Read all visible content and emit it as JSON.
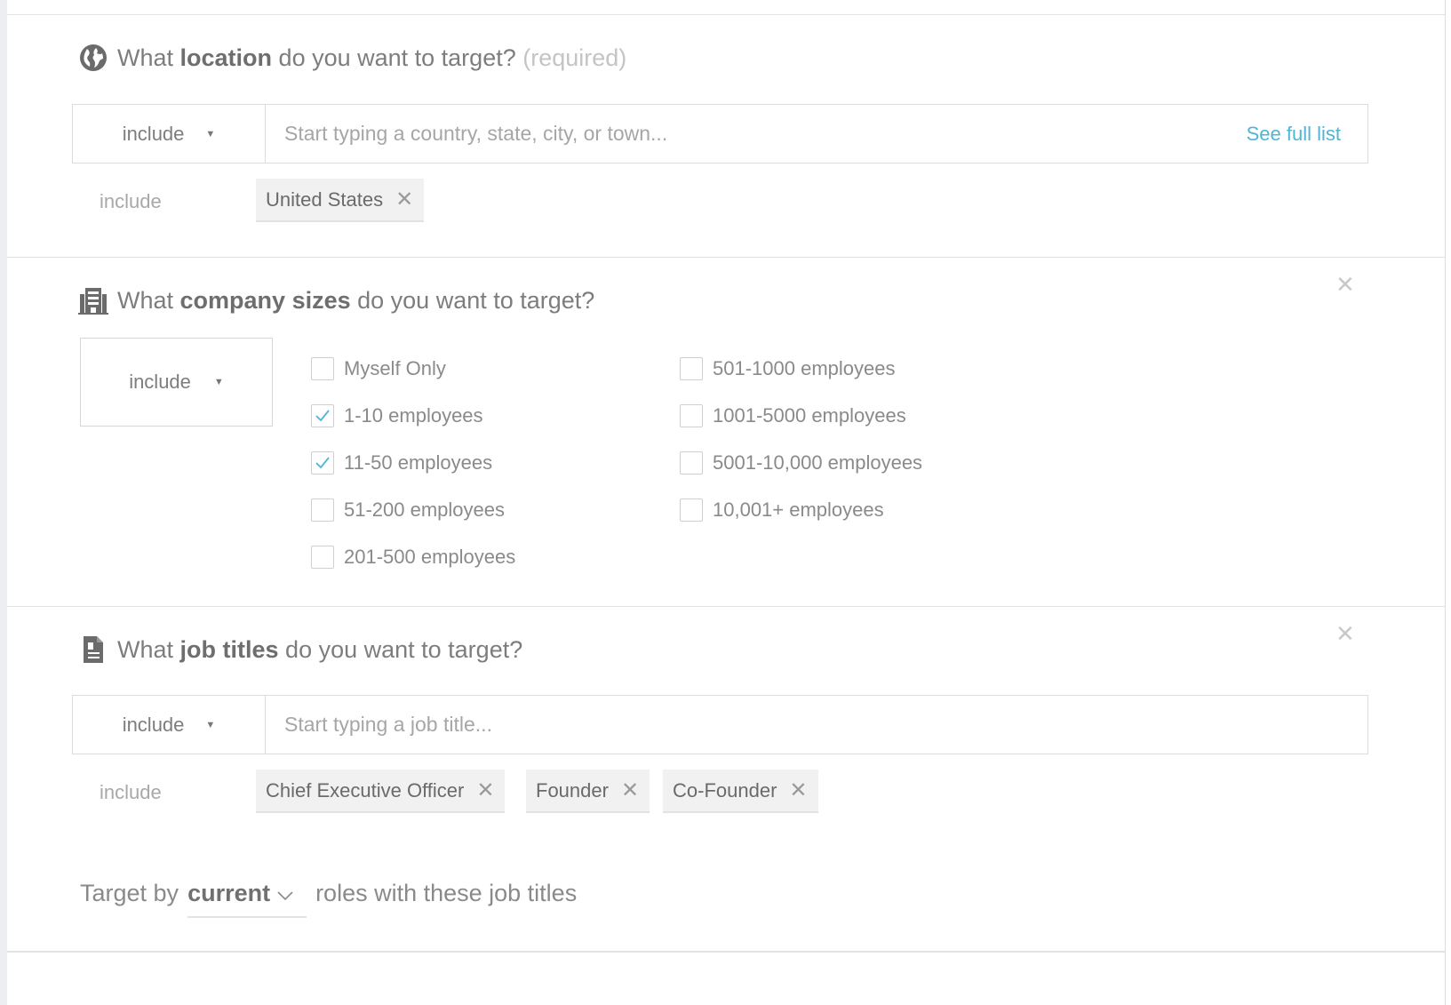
{
  "location": {
    "heading_pre": "What ",
    "heading_bold": "location",
    "heading_post": " do you want to target?",
    "heading_req": " (required)",
    "mode": "include",
    "placeholder": "Start typing a country, state, city, or town...",
    "see_full_list": "See full list",
    "include_label": "include",
    "tags": [
      "United States"
    ]
  },
  "company": {
    "heading_pre": "What ",
    "heading_bold": "company sizes",
    "heading_post": " do you want to target?",
    "mode": "include",
    "options": [
      {
        "label": "Myself Only",
        "checked": false
      },
      {
        "label": "1-10 employees",
        "checked": true
      },
      {
        "label": "11-50 employees",
        "checked": true
      },
      {
        "label": "51-200 employees",
        "checked": false
      },
      {
        "label": "201-500 employees",
        "checked": false
      },
      {
        "label": "501-1000 employees",
        "checked": false
      },
      {
        "label": "1001-5000 employees",
        "checked": false
      },
      {
        "label": "5001-10,000 employees",
        "checked": false
      },
      {
        "label": "10,001+ employees",
        "checked": false
      }
    ]
  },
  "jobs": {
    "heading_pre": "What ",
    "heading_bold": "job titles",
    "heading_post": " do you want to target?",
    "mode": "include",
    "placeholder": "Start typing a job title...",
    "include_label": "include",
    "tags": [
      "Chief Executive Officer",
      "Founder",
      "Co-Founder"
    ],
    "target_prefix": "Target by",
    "target_value": "current",
    "target_suffix": "roles with these job titles"
  },
  "icons": {
    "location": "globe-icon",
    "company": "building-icon",
    "jobs": "document-icon",
    "close": "close-icon",
    "remove": "remove-tag-icon",
    "caret": "caret-down-icon",
    "check": "checkmark-icon"
  },
  "colors": {
    "link": "#4fb5d6",
    "check": "#4fb5d6",
    "text": "#8a8a8a"
  }
}
